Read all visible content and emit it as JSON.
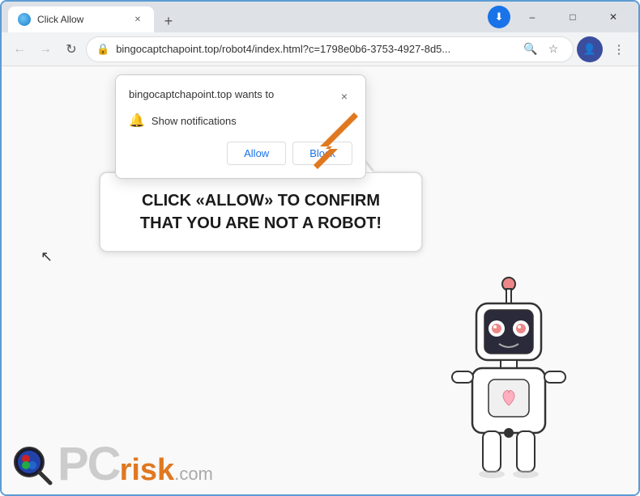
{
  "browser": {
    "tab": {
      "title": "Click Allow",
      "favicon_label": "favicon"
    },
    "new_tab_label": "+",
    "window_controls": {
      "minimize": "–",
      "maximize": "□",
      "close": "✕"
    },
    "address_bar": {
      "back_icon": "←",
      "forward_icon": "→",
      "reload_icon": "↻",
      "url": "bingocaptchapoint.top/robot4/index.html?c=1798e0b6-3753-4927-8d5...",
      "lock_icon": "🔒",
      "search_icon": "🔍",
      "star_icon": "☆",
      "profile_icon": "👤",
      "menu_icon": "⋮",
      "download_icon": "⬇"
    }
  },
  "notification_popup": {
    "site_text": "bingocaptchapoint.top wants to",
    "close_icon": "×",
    "notification_label": "Show notifications",
    "bell_icon": "🔔",
    "allow_button": "Allow",
    "block_button": "Block"
  },
  "cta": {
    "text": "CLICK «ALLOW» TO CONFIRM THAT YOU ARE NOT A ROBOT!"
  },
  "pcrisk": {
    "pc_text": "PC",
    "risk_text": "risk",
    "com_text": ".com"
  },
  "colors": {
    "arrow_fill": "#e07820",
    "cta_text": "#1a1a1a",
    "allow_button": "#1a73e8",
    "browser_border": "#5b9bd5"
  }
}
